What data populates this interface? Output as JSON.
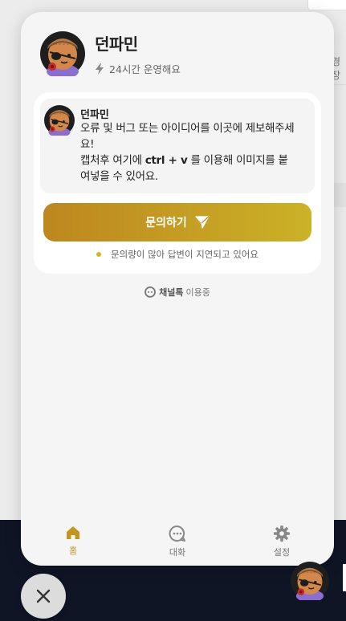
{
  "background": {
    "partial_text": "경장"
  },
  "messenger": {
    "channel_name": "던파민",
    "hours_text": "24시간 운영해요",
    "greeting": {
      "sender": "던파민",
      "line1": "오류 및 버그 또는 아이디어를 이곳에 제보해주세요!",
      "line2_prefix": "캡처후 여기에 ",
      "line2_shortcut": "ctrl + v",
      "line2_suffix": " 를 이용해 이미지를 붙여넣을 수 있어요."
    },
    "ask_button_label": "문의하기",
    "notice_text": "문의량이 많아 답변이 지연되고 있어요",
    "powered": {
      "brand": "채널톡",
      "suffix": "이용중"
    },
    "tabs": [
      {
        "label": "홈",
        "icon": "home-icon",
        "active": true
      },
      {
        "label": "대화",
        "icon": "chat-icon",
        "active": false
      },
      {
        "label": "설정",
        "icon": "gear-icon",
        "active": false
      }
    ]
  },
  "colors": {
    "accent": "#c39622",
    "button_gradient_start": "#bd871f",
    "button_gradient_end": "#cbb227",
    "footer_bg": "#0f1525"
  }
}
